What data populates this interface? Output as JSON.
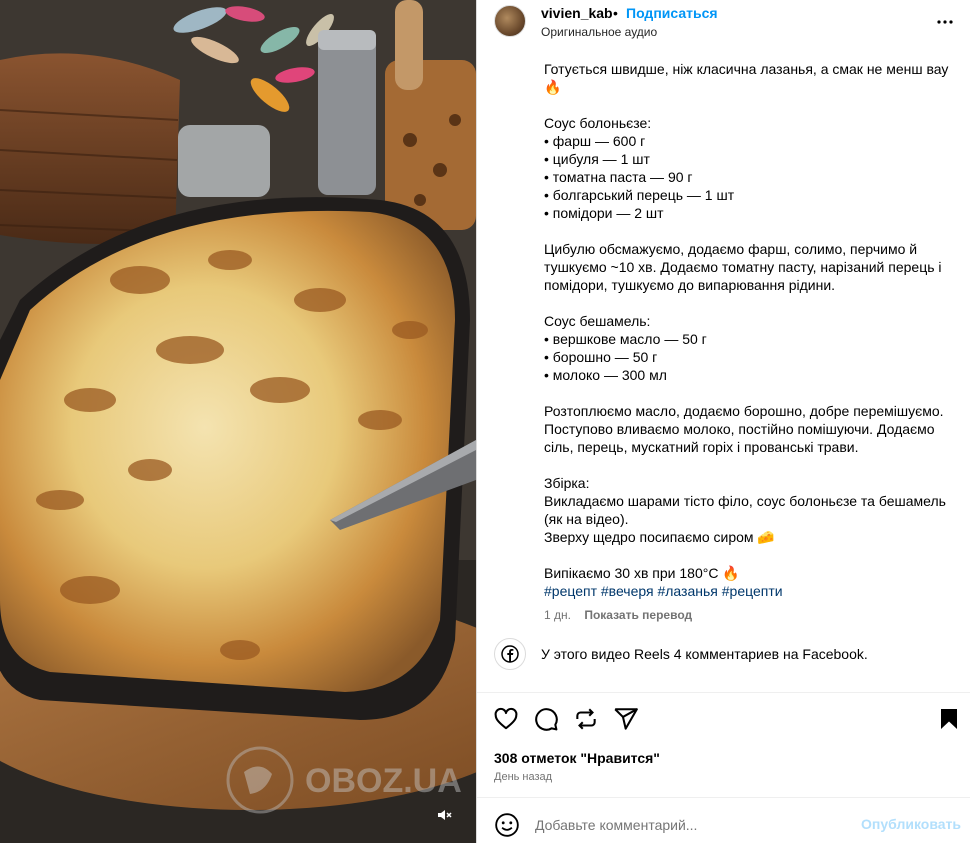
{
  "post": {
    "username": "vivien_kab",
    "separator": "•",
    "follow_label": "Подписаться",
    "audio_label": "Оригинальное аудио"
  },
  "caption": {
    "lines": [
      "Готується швидше, ніж класична лазанья, а смак не менш вау",
      "🔥",
      "",
      "Соус болоньєзе:",
      "• фарш — 600 г",
      "• цибуля — 1 шт",
      "• томатна паста — 90 г",
      "• болгарський перець — 1 шт",
      "• помідори — 2 шт",
      "",
      "Цибулю обсмажуємо, додаємо фарш, солимо, перчимо й тушкуємо ~10 хв. Додаємо томатну пасту, нарізаний перець і помідори, тушкуємо до випарювання рідини.",
      "",
      "Соус бешамель:",
      "• вершкове масло — 50 г",
      "• борошно — 50 г",
      "• молоко — 300 мл",
      "",
      "Розтоплюємо масло, додаємо борошно, добре перемішуємо. Поступово вливаємо молоко, постійно помішуючи. Додаємо сіль, перець, мускатний горіх і прованські трави.",
      "",
      "Збірка:",
      "Викладаємо шарами тісто філо, соус болоньєзе та бешамель (як на відео).",
      "Зверху щедро посипаємо сиром 🧀",
      "",
      "Випікаємо 30 хв при 180°C 🔥"
    ],
    "hashtags": [
      "#рецепт",
      "#вечеря",
      "#лазанья",
      "#рецепти"
    ],
    "time": "1 дн.",
    "translate_label": "Показать перевод"
  },
  "facebook": {
    "text": "У этого видео Reels 4 комментариев на Facebook."
  },
  "stats": {
    "likes": "308 отметок \"Нравится\"",
    "posted": "День назад"
  },
  "comment": {
    "placeholder": "Добавьте комментарий...",
    "post_label": "Опубликовать"
  },
  "watermark": {
    "text": "OBOZ.UA"
  },
  "colors": {
    "link": "#0095f6",
    "hashtag": "#00376b",
    "muted": "#737373",
    "post_disabled": "#b2dffc"
  }
}
